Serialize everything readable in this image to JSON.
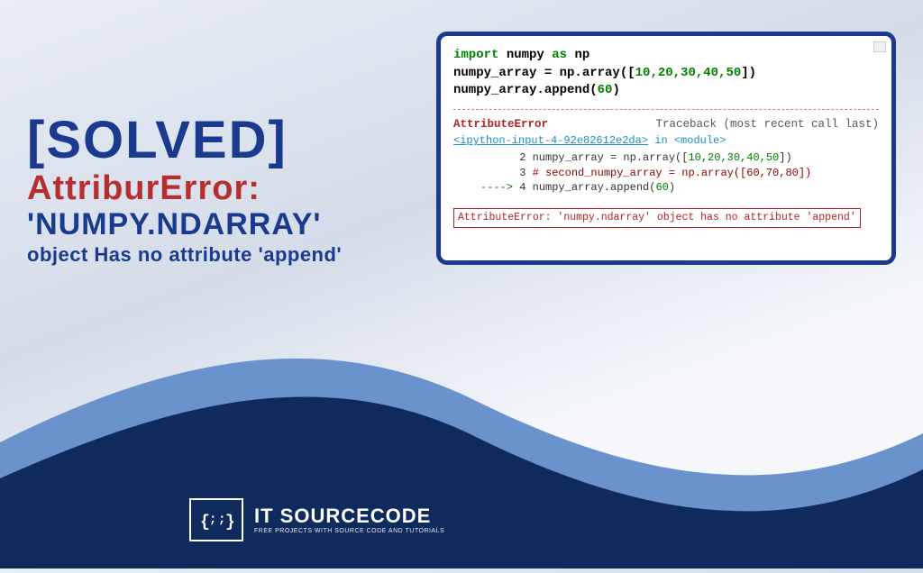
{
  "title": {
    "solved": "[SOLVED]",
    "error": "AttriburError:",
    "numpy": "'NUMPY.NDARRAY'",
    "sub": "object Has no attribute 'append'"
  },
  "code": {
    "line1": {
      "import": "import",
      "numpy": " numpy ",
      "as": "as",
      "np": " np"
    },
    "line2_prefix": "numpy_array = np.array([",
    "line2_nums": "10,20,30,40,50",
    "line2_suffix": "])",
    "line3_prefix": "numpy_array.append(",
    "line3_num": "60",
    "line3_suffix": ")"
  },
  "traceback": {
    "error_name": "AttributeError",
    "call_last": "Traceback (most recent call last)",
    "link": "<ipython-input-4-92e82612e2da>",
    "in_module": " in <module>",
    "tl2_a": "      2 numpy_array = np.array([",
    "tl2_b": "10,20,30,40,50",
    "tl2_c": "])",
    "tl3_a": "      3 ",
    "tl3_b": "# second_numpy_array = np.array([60,70,80])",
    "tl4_a": "----> ",
    "tl4_b": "4 numpy_array.append(",
    "tl4_c": "60",
    "tl4_d": ")",
    "final": "AttributeError: 'numpy.ndarray' object has no attribute 'append'"
  },
  "logo": {
    "title": "IT SOURCECODE",
    "sub": "FREE PROJECTS WITH SOURCE CODE AND TUTORIALS"
  }
}
